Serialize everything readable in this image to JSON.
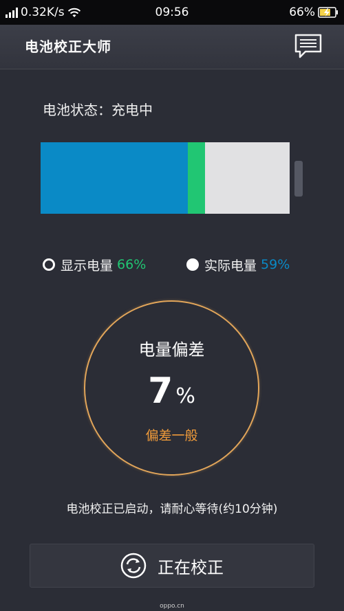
{
  "status_bar": {
    "speed": "0.32K/s",
    "time": "09:56",
    "battery": "66%",
    "icons": [
      "signal-icon",
      "wifi-icon",
      "charging-battery-icon"
    ]
  },
  "header": {
    "title": "电池校正大师",
    "message_icon": "message-icon"
  },
  "battery": {
    "status_label": "电池状态：充电中",
    "actual_level": 0.59,
    "display_level": 0.66,
    "colors": {
      "actual": "#0a8ac6",
      "difference": "#21c673",
      "empty": "#e1e1e3"
    }
  },
  "legend": {
    "display_label": "显示电量",
    "display_value": "66%",
    "actual_label": "实际电量",
    "actual_value": "59%"
  },
  "deviation": {
    "title": "电量偏差",
    "value": "7",
    "unit": "%",
    "level": "偏差一般",
    "ring_color": "#e3a65a",
    "level_color": "#ee9a3a"
  },
  "message": "电池校正已启动，请耐心等待(约10分钟)",
  "calibrate_button": {
    "label": "正在校正",
    "icon": "refresh-icon"
  },
  "watermark": "oppo.cn"
}
